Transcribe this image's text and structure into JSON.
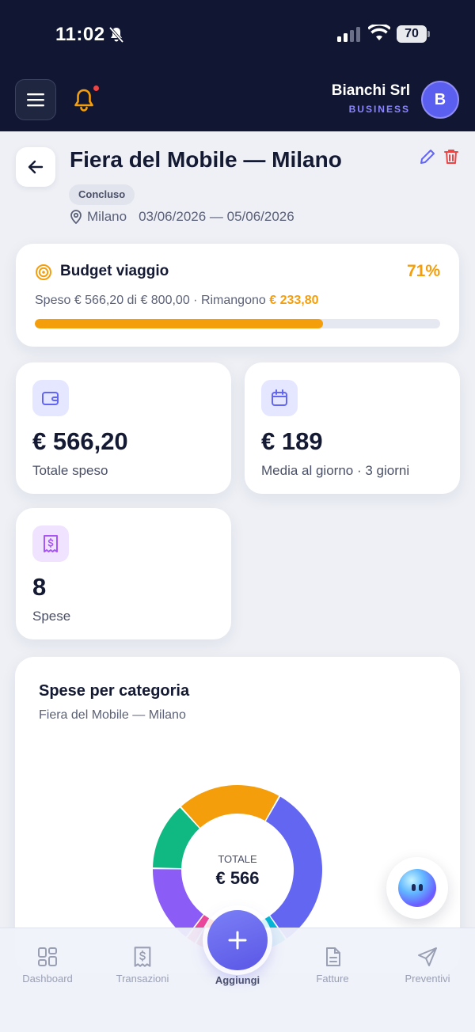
{
  "status_bar": {
    "time": "11:02",
    "battery": "70"
  },
  "header": {
    "company_name": "Bianchi Srl",
    "company_type": "BUSINESS",
    "avatar_initial": "B"
  },
  "event": {
    "title": "Fiera del Mobile — Milano",
    "status": "Concluso",
    "location": "Milano",
    "dates": "03/06/2026 — 05/06/2026"
  },
  "budget": {
    "label": "Budget viaggio",
    "percent_label": "71%",
    "percent": 71,
    "spent_text": "Speso € 566,20 di € 800,00 · Rimangono ",
    "remaining": "€ 233,80",
    "color": "#f59e0b"
  },
  "stats": {
    "total": {
      "value": "€ 566,20",
      "caption": "Totale speso",
      "icon": "wallet-icon"
    },
    "daily": {
      "value": "€ 189",
      "caption": "Media al giorno · 3 giorni",
      "icon": "calendar-icon"
    },
    "count": {
      "value": "8",
      "caption": "Spese",
      "icon": "receipt-icon"
    }
  },
  "chart": {
    "title": "Spese per categoria",
    "subtitle": "Fiera del Mobile — Milano",
    "center_label": "TOTALE",
    "center_value": "€ 566"
  },
  "chart_data": {
    "type": "pie",
    "title": "Spese per categoria",
    "slices": [
      {
        "color": "#6366f1",
        "value": 32
      },
      {
        "color": "#06b6d4",
        "value": 5
      },
      {
        "color": "#ef4444",
        "value": 13
      },
      {
        "color": "#ec4899",
        "value": 2
      },
      {
        "color": "#8b5cf6",
        "value": 15
      },
      {
        "color": "#10b981",
        "value": 13
      },
      {
        "color": "#f59e0b",
        "value": 20
      }
    ]
  },
  "tabs": [
    {
      "label": "Dashboard",
      "icon": "dashboard-icon"
    },
    {
      "label": "Transazioni",
      "icon": "receipt-icon"
    },
    {
      "label": "Aggiungi",
      "icon": "plus-icon"
    },
    {
      "label": "Fatture",
      "icon": "document-icon"
    },
    {
      "label": "Preventivi",
      "icon": "send-icon"
    }
  ],
  "colors": {
    "accent": "#5b5ff0",
    "navy": "#111733",
    "warning": "#f59e0b",
    "danger": "#ef4444"
  }
}
